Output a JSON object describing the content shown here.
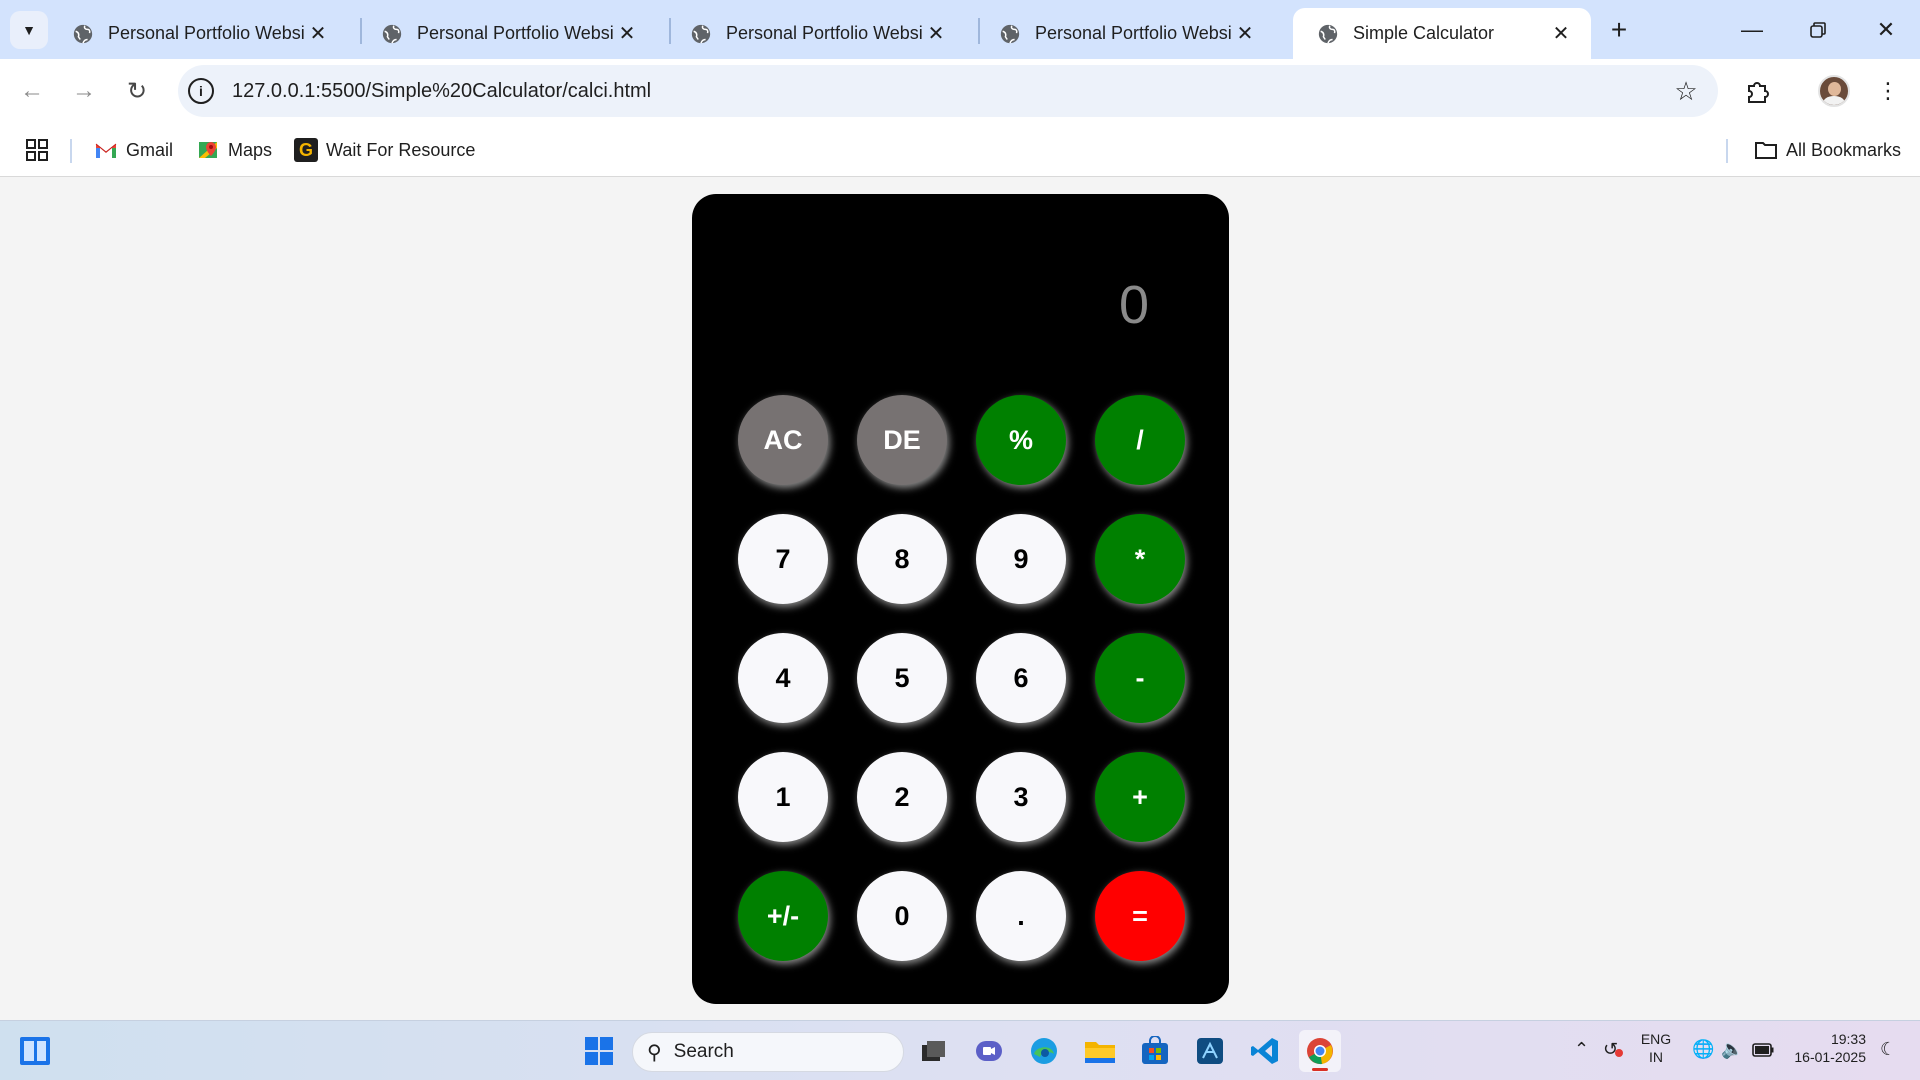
{
  "browser": {
    "tabs": [
      {
        "title": "Personal Portfolio Website",
        "active": false
      },
      {
        "title": "Personal Portfolio Website",
        "active": false
      },
      {
        "title": "Personal Portfolio Website",
        "active": false
      },
      {
        "title": "Personal Portfolio Website",
        "active": false
      },
      {
        "title": "Simple Calculator",
        "active": true
      }
    ],
    "url": "127.0.0.1:5500/Simple%20Calculator/calci.html",
    "bookmarks": [
      {
        "label": "Gmail",
        "icon": "gmail-icon"
      },
      {
        "label": "Maps",
        "icon": "maps-icon"
      },
      {
        "label": "Wait For Resource",
        "icon": "g-logo-icon"
      }
    ],
    "all_bookmarks_label": "All Bookmarks"
  },
  "calculator": {
    "display": "0",
    "keys": [
      {
        "label": "AC",
        "kind": "fn",
        "name": "all-clear"
      },
      {
        "label": "DE",
        "kind": "fn",
        "name": "delete"
      },
      {
        "label": "%",
        "kind": "op",
        "name": "percent"
      },
      {
        "label": "/",
        "kind": "op",
        "name": "divide"
      },
      {
        "label": "7",
        "kind": "num",
        "name": "7"
      },
      {
        "label": "8",
        "kind": "num",
        "name": "8"
      },
      {
        "label": "9",
        "kind": "num",
        "name": "9"
      },
      {
        "label": "*",
        "kind": "op",
        "name": "multiply"
      },
      {
        "label": "4",
        "kind": "num",
        "name": "4"
      },
      {
        "label": "5",
        "kind": "num",
        "name": "5"
      },
      {
        "label": "6",
        "kind": "num",
        "name": "6"
      },
      {
        "label": "-",
        "kind": "op",
        "name": "subtract"
      },
      {
        "label": "1",
        "kind": "num",
        "name": "1"
      },
      {
        "label": "2",
        "kind": "num",
        "name": "2"
      },
      {
        "label": "3",
        "kind": "num",
        "name": "3"
      },
      {
        "label": "+",
        "kind": "op",
        "name": "add"
      },
      {
        "label": "+/-",
        "kind": "op",
        "name": "toggle-sign"
      },
      {
        "label": "0",
        "kind": "num",
        "name": "0"
      },
      {
        "label": ".",
        "kind": "num",
        "name": "decimal"
      },
      {
        "label": "=",
        "kind": "eq",
        "name": "equals"
      }
    ],
    "colors": {
      "body": "#000000",
      "number_key": "#f8f8fb",
      "function_key": "#777272",
      "operator_key": "#008000",
      "equals_key": "#ff0000",
      "display_text": "#8a8a8a"
    }
  },
  "taskbar": {
    "search_placeholder": "Search",
    "language": "ENG",
    "region": "IN",
    "time": "19:33",
    "date": "16-01-2025"
  }
}
